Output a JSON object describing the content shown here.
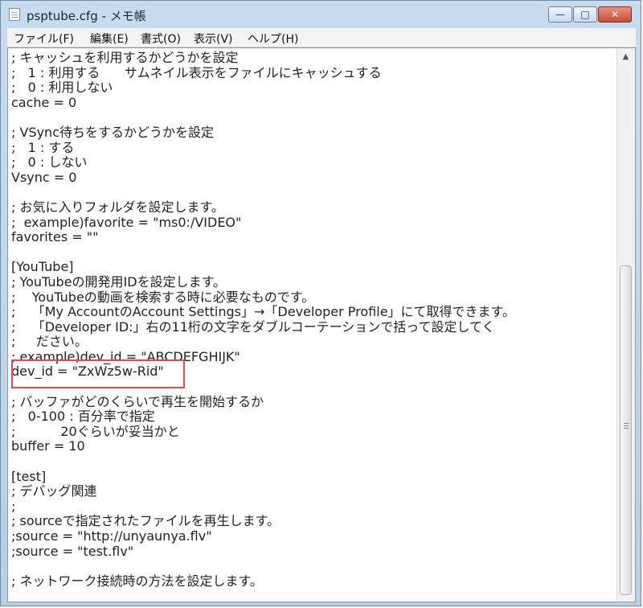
{
  "window": {
    "title": "psptube.cfg - メモ帳",
    "buttons": {
      "minimize": "—",
      "maximize": "□",
      "close": "✕"
    }
  },
  "menu": [
    "ファイル(F)",
    "編集(E)",
    "書式(O)",
    "表示(V)",
    "ヘルプ(H)"
  ],
  "editor": {
    "lines": [
      "; キャッシュを利用するかどうかを設定",
      ";   1 : 利用する      サムネイル表示をファイルにキャッシュする",
      ";   0 : 利用しない",
      "cache = 0",
      "",
      "; VSync待ちをするかどうかを設定",
      ";   1 : する",
      ";   0 : しない",
      "Vsync = 0",
      "",
      "; お気に入りフォルダを設定します。",
      ";  example)favorite = \"ms0:/VIDEO\"",
      "favorites = \"\"",
      "",
      "[YouTube]",
      "; YouTubeの開発用IDを設定します。",
      ";    YouTubeの動画を検索する時に必要なものです。",
      ";    「My AccountのAccount Settings」→「Developer Profile」にて取得できます。",
      ";    「Developer ID:」右の11桁の文字をダブルコーテーションで括って設定してく",
      ";     ださい。",
      "; example)dev_id = \"ABCDEFGHIJK\"",
      "dev_id = \"ZxWz5w-Rid\"",
      "",
      "; バッファがどのくらいで再生を開始するか",
      ";   0-100 : 百分率で指定",
      ";           20ぐらいが妥当かと",
      "buffer = 10",
      "",
      "[test]",
      "; デバッグ関連",
      ";",
      "; sourceで指定されたファイルを再生します。",
      ";source = \"http://unyaunya.flv\"",
      ";source = \"test.flv\"",
      "",
      "; ネットワーク接続時の方法を設定します。"
    ]
  }
}
